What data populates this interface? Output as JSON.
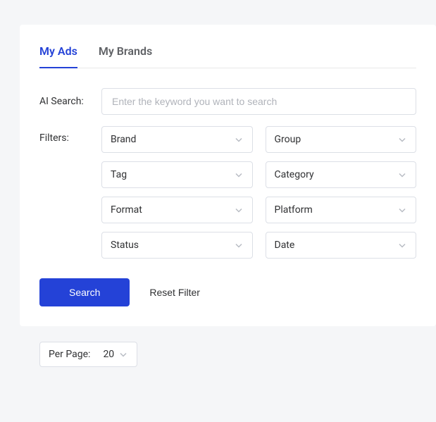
{
  "tabs": {
    "my_ads": "My Ads",
    "my_brands": "My Brands"
  },
  "search": {
    "label": "AI Search:",
    "placeholder": "Enter the keyword you want to search"
  },
  "filters": {
    "label": "Filters:",
    "items": [
      "Brand",
      "Group",
      "Tag",
      "Category",
      "Format",
      "Platform",
      "Status",
      "Date"
    ]
  },
  "buttons": {
    "search": "Search",
    "reset": "Reset Filter"
  },
  "perPage": {
    "label": "Per Page:",
    "value": "20"
  }
}
